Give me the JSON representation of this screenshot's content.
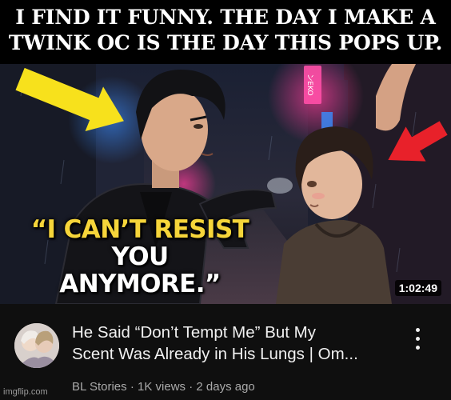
{
  "meme": {
    "caption_line1": "I FIND IT FUNNY. THE DAY I MAKE A",
    "caption_line2": "TWINK OC IS THE DAY THIS POPS UP."
  },
  "thumbnail": {
    "quote_highlight": "“I CAN’T RESIST",
    "quote_rest": " YOU",
    "quote_line2": "ANYMORE.”",
    "neon_sign_text": "ンEKO",
    "duration": "1:02:49",
    "colors": {
      "quote_highlight": "#f6d53a",
      "arrow_yellow": "#f7e11c",
      "arrow_red": "#e8212a",
      "neon_pink": "#ff3d9a",
      "neon_blue": "#3a8dff"
    }
  },
  "video": {
    "title_line1": "He Said “Don’t Tempt Me” But My",
    "title_line2": "Scent Was Already in His Lungs | Om...",
    "channel": "BL Stories",
    "views": "1K views",
    "age": "2 days ago",
    "separator": " · "
  },
  "watermark": "imgflip.com"
}
